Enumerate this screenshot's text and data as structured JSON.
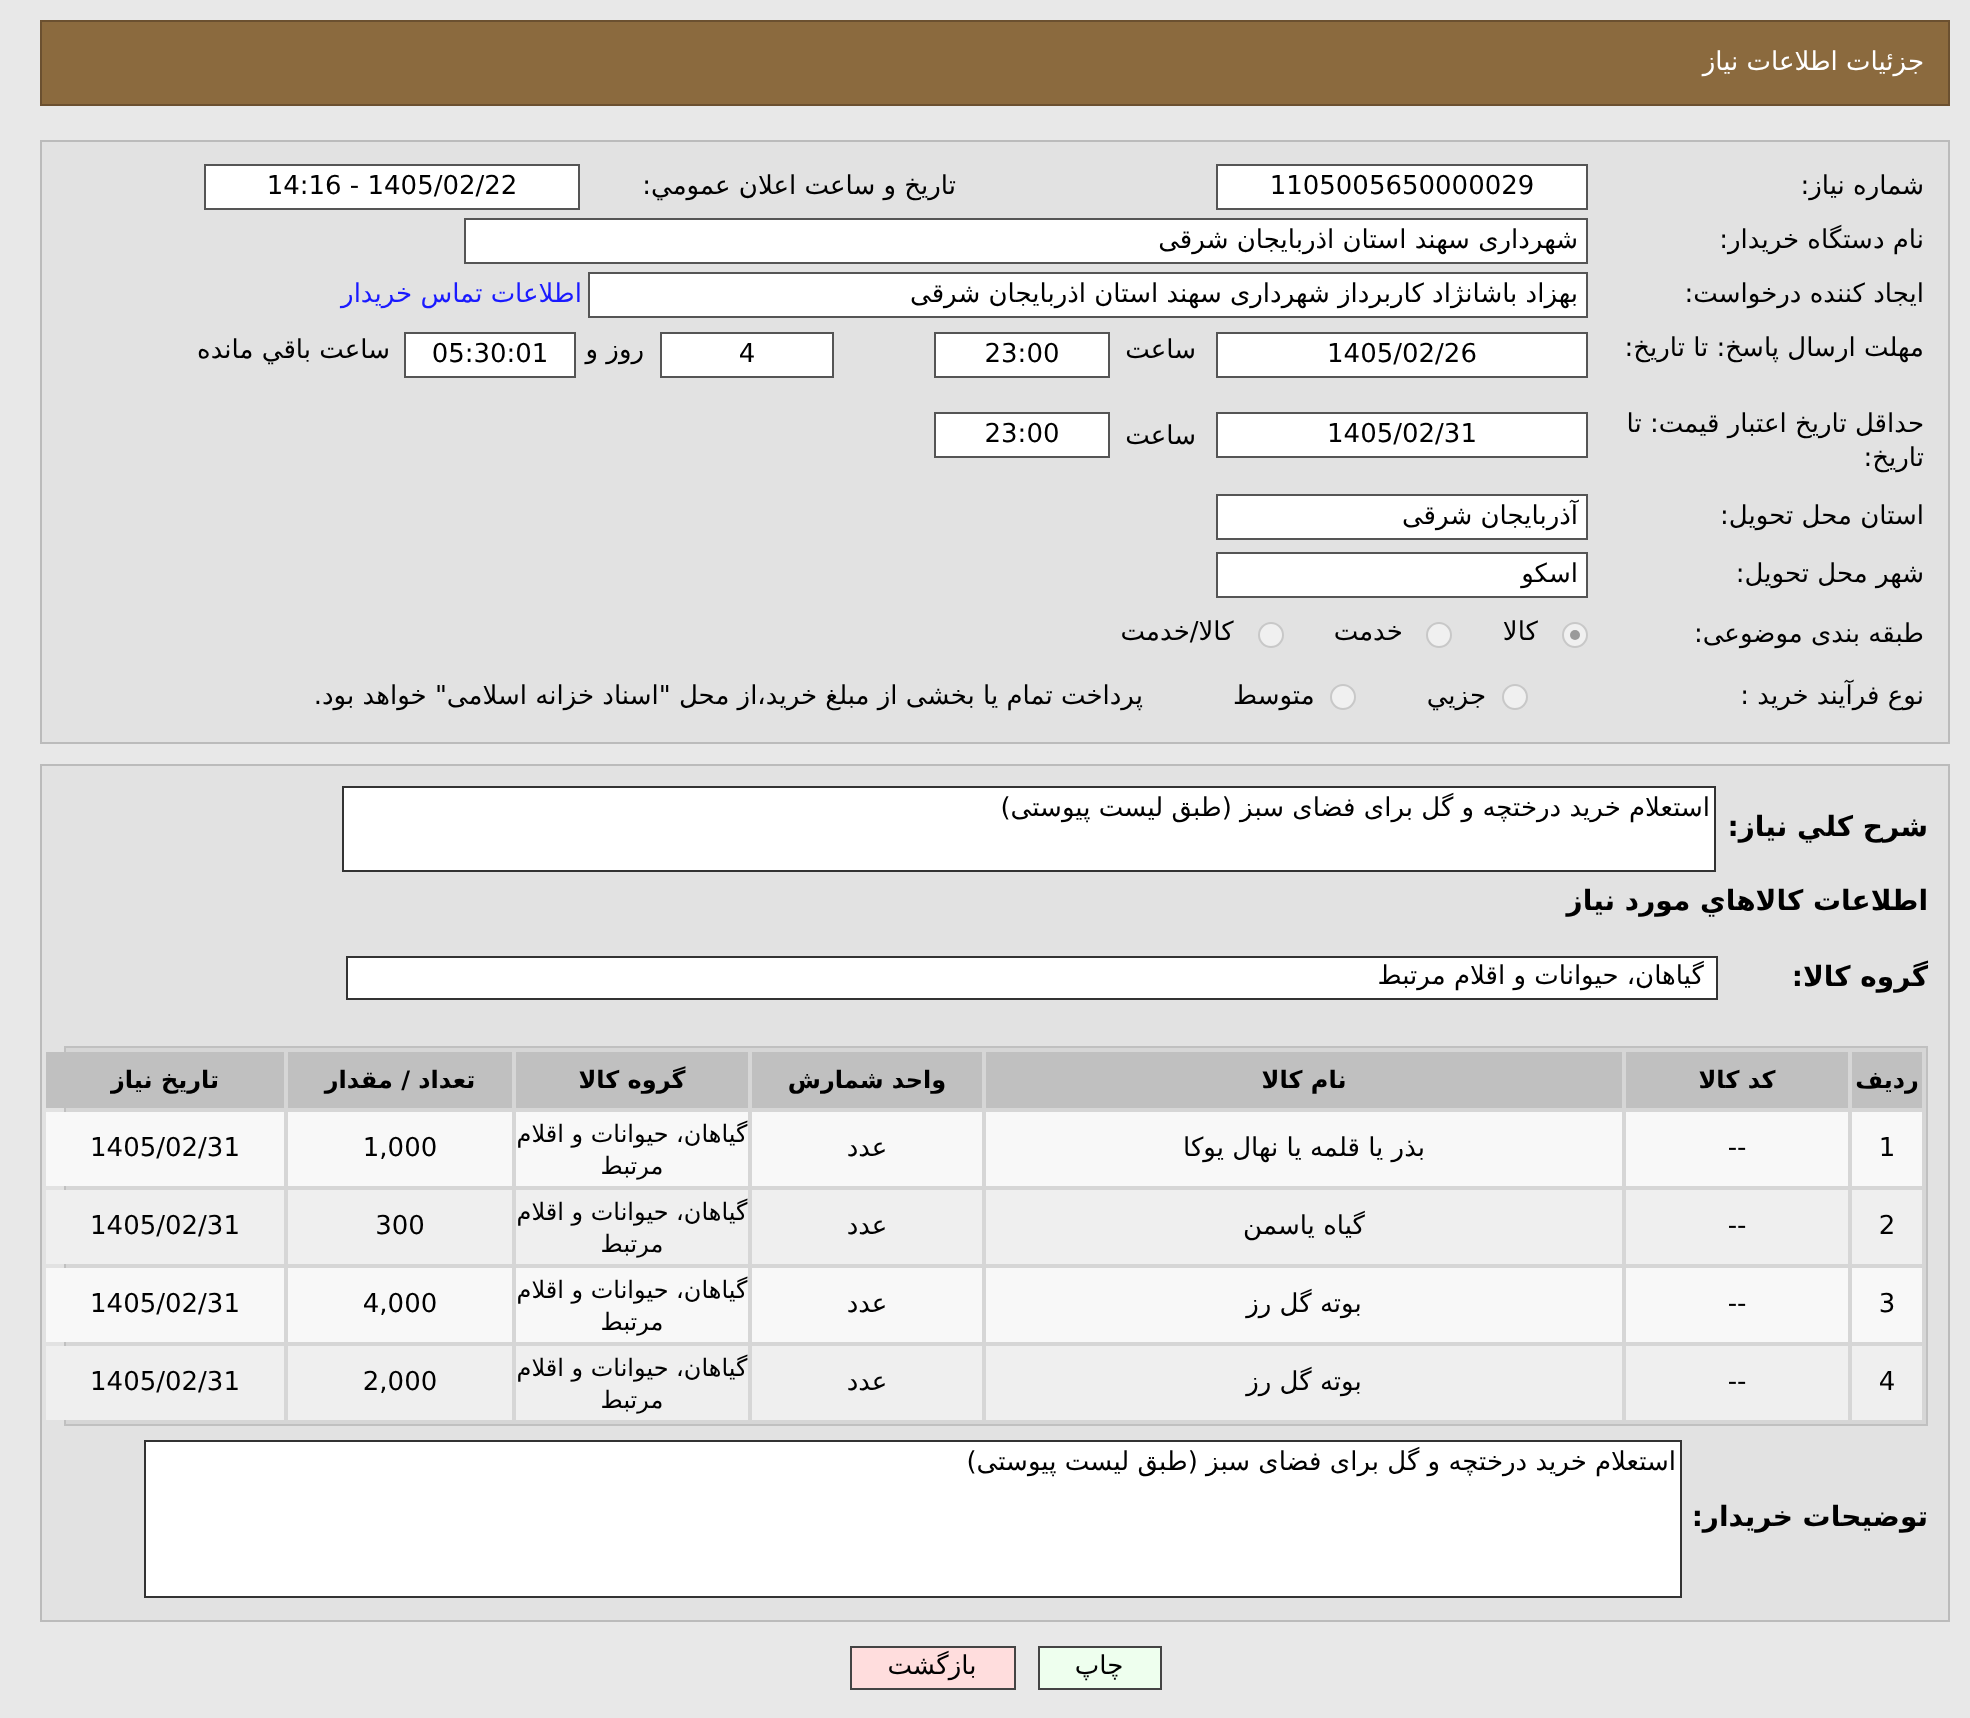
{
  "header": {
    "title": "جزئیات اطلاعات نیاز"
  },
  "need_number": {
    "label": "شماره نیاز:",
    "value": "1105005650000029"
  },
  "announce": {
    "label": "تاريخ و ساعت اعلان عمومي:",
    "value": "1405/02/22 - 14:16"
  },
  "buyer_org": {
    "label": "نام دستگاه خریدار:",
    "value": "شهرداری سهند استان اذربایجان شرقی"
  },
  "requester": {
    "label": "ایجاد کننده درخواست:",
    "value": "بهزاد باشانژاد کاربرداز شهرداری سهند استان اذربایجان شرقی",
    "link": "اطلاعات تماس خریدار"
  },
  "reply_deadline": {
    "label": "مهلت ارسال پاسخ: تا تاریخ:",
    "date": "1405/02/26",
    "time_label": "ساعت",
    "time": "23:00",
    "days": "4",
    "days_label": "روز و",
    "remaining": "05:30:01",
    "remaining_label": "ساعت باقي مانده"
  },
  "price_validity": {
    "label": "حداقل تاریخ اعتبار قیمت: تا تاریخ:",
    "date": "1405/02/31",
    "time_label": "ساعت",
    "time": "23:00"
  },
  "province": {
    "label": "استان محل تحویل:",
    "value": "آذربایجان شرقی"
  },
  "city": {
    "label": "شهر محل تحویل:",
    "value": "اسکو"
  },
  "category": {
    "label": "طبقه بندی موضوعی:",
    "options": [
      {
        "label": "کالا",
        "selected": true
      },
      {
        "label": "خدمت",
        "selected": false
      },
      {
        "label": "کالا/خدمت",
        "selected": false
      }
    ]
  },
  "process": {
    "label": "نوع فرآیند خرید :",
    "options": [
      {
        "label": "جزيي",
        "selected": false
      },
      {
        "label": "متوسط",
        "selected": false
      }
    ],
    "note": "پرداخت تمام یا بخشی از مبلغ خرید،از محل \"اسناد خزانه اسلامی\" خواهد بود."
  },
  "description": {
    "label": "شرح کلي نياز:",
    "value": "استعلام خرید درختچه و گل برای فضای سبز (طبق لیست پیوستی)"
  },
  "goods_title": "اطلاعات کالاهاي مورد نياز",
  "goods_group": {
    "label": "گروه کالا:",
    "value": "گیاهان، حیوانات و اقلام مرتبط"
  },
  "table": {
    "columns": [
      "ردیف",
      "کد کالا",
      "نام کالا",
      "واحد شمارش",
      "گروه کالا",
      "تعداد / مقدار",
      "تاریخ نیاز"
    ],
    "rows": [
      [
        "1",
        "--",
        "بذر یا قلمه یا نهال یوکا",
        "عدد",
        "گیاهان، حیوانات و اقلام مرتبط",
        "1,000",
        "1405/02/31"
      ],
      [
        "2",
        "--",
        "گیاه یاسمن",
        "عدد",
        "گیاهان، حیوانات و اقلام مرتبط",
        "300",
        "1405/02/31"
      ],
      [
        "3",
        "--",
        "بوته گل رز",
        "عدد",
        "گیاهان، حیوانات و اقلام مرتبط",
        "4,000",
        "1405/02/31"
      ],
      [
        "4",
        "--",
        "بوته گل رز",
        "عدد",
        "گیاهان، حیوانات و اقلام مرتبط",
        "2,000",
        "1405/02/31"
      ]
    ]
  },
  "buyer_notes": {
    "label": "توضیحات خریدار:",
    "value": "استعلام خرید درختچه و گل برای فضای سبز (طبق لیست پیوستی)"
  },
  "buttons": [
    {
      "kind": "print",
      "label": "چاپ"
    },
    {
      "kind": "back",
      "label": "بازگشت"
    }
  ]
}
